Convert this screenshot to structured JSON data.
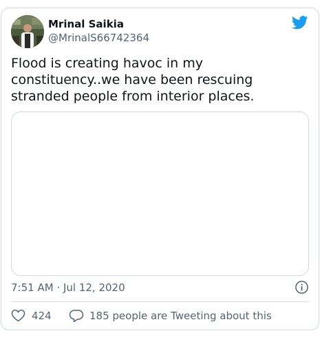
{
  "tweet": {
    "author": {
      "display_name": "Mrinal Saikia",
      "handle": "@MrinalS66742364"
    },
    "text": "Flood is creating havoc in my constituency..we have been rescuing stranded people from interior places.",
    "timestamp": "7:51 AM · Jul 12, 2020",
    "likes": "424",
    "reply_text": "185 people are Tweeting about this"
  },
  "colors": {
    "twitter_blue": "#1d9bf0",
    "secondary_text": "#536471",
    "border": "#cfd9de"
  },
  "icons": [
    "twitter-logo-icon",
    "info-icon",
    "heart-icon",
    "reply-bubble-icon"
  ]
}
